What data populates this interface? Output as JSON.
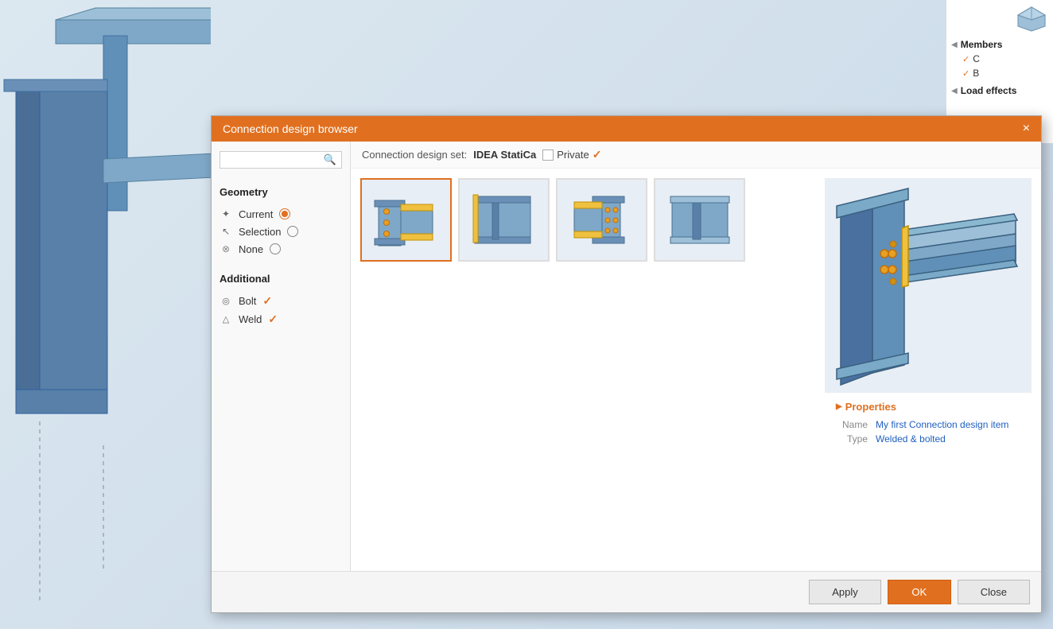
{
  "scene": {
    "bg_color": "#c8d8e8"
  },
  "right_tree": {
    "title_members": "Members",
    "item_c": "C",
    "item_b": "B",
    "title_load_effects": "Load effects"
  },
  "dialog": {
    "title": "Connection design browser",
    "close_label": "×",
    "connection_design_set_label": "Connection design set:",
    "set_name": "IDEA StatiCa",
    "private_label": "Private",
    "geometry_title": "Geometry",
    "current_label": "Current",
    "selection_label": "Selection",
    "none_label": "None",
    "additional_title": "Additional",
    "bolt_label": "Bolt",
    "weld_label": "Weld",
    "properties_title": "Properties",
    "prop_name_label": "Name",
    "prop_name_value": "My first Connection design item",
    "prop_type_label": "Type",
    "prop_type_value": "Welded & bolted"
  },
  "footer": {
    "apply_label": "Apply",
    "ok_label": "OK",
    "close_label": "Close"
  }
}
